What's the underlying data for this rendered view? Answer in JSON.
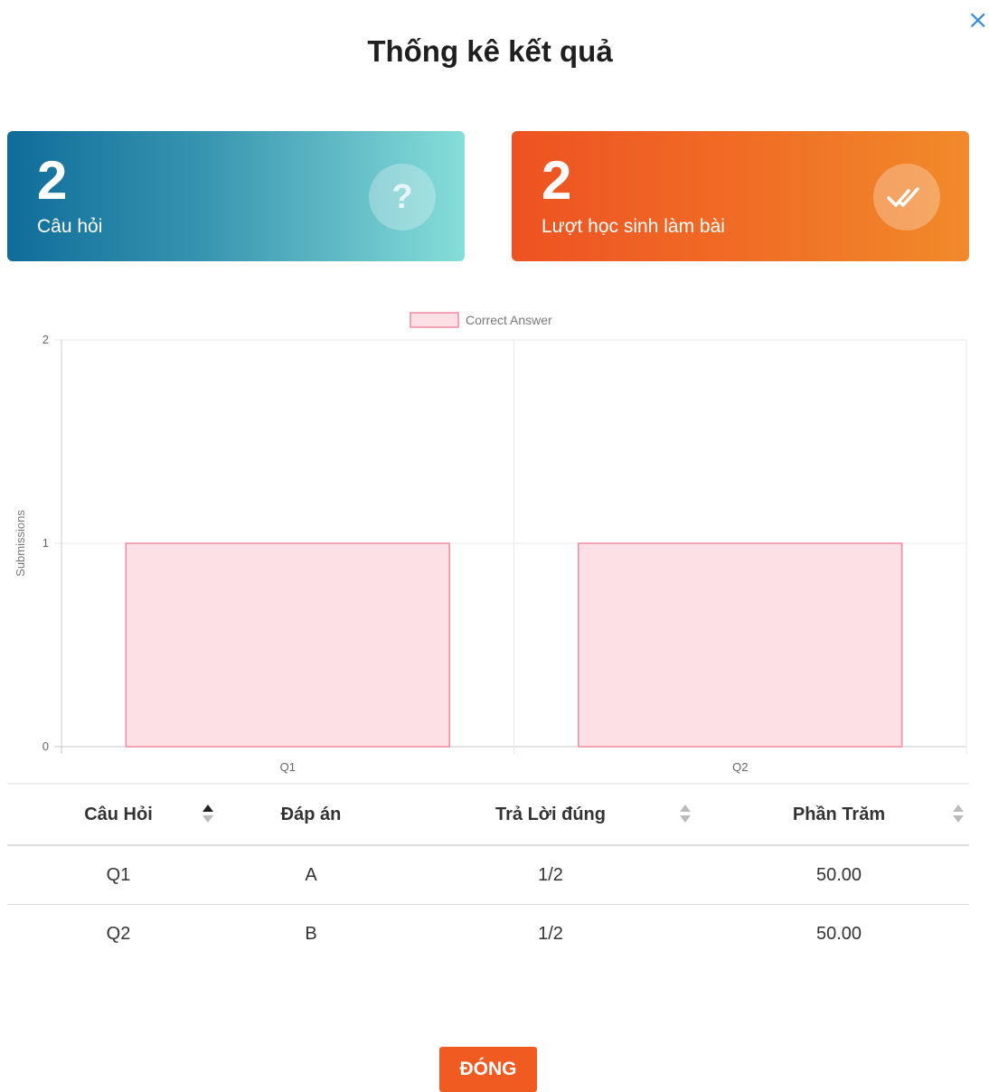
{
  "modal": {
    "title": "Thống kê kết quả",
    "close_icon": "×",
    "close_button_label": "ĐÓNG"
  },
  "cards": {
    "questions": {
      "value": "2",
      "label": "Câu hỏi",
      "icon": "question-icon",
      "icon_glyph": "?"
    },
    "submissions": {
      "value": "2",
      "label": "Lượt học sinh làm bài",
      "icon": "double-check-icon"
    }
  },
  "chart_data": {
    "type": "bar",
    "categories": [
      "Q1",
      "Q2"
    ],
    "series": [
      {
        "name": "Correct Answer",
        "values": [
          1,
          1
        ],
        "color": "#fde0e6",
        "border": "#f08aa2"
      }
    ],
    "ylabel": "Submissions",
    "ylim": [
      0,
      2
    ],
    "yticks": [
      "0",
      "1",
      "2"
    ],
    "grid": true,
    "legend": "top-center"
  },
  "table": {
    "columns": [
      "Câu Hỏi",
      "Đáp án",
      "Trả Lời đúng",
      "Phần Trăm"
    ],
    "rows": [
      [
        "Q1",
        "A",
        "1/2",
        "50.00"
      ],
      [
        "Q2",
        "B",
        "1/2",
        "50.00"
      ]
    ]
  }
}
